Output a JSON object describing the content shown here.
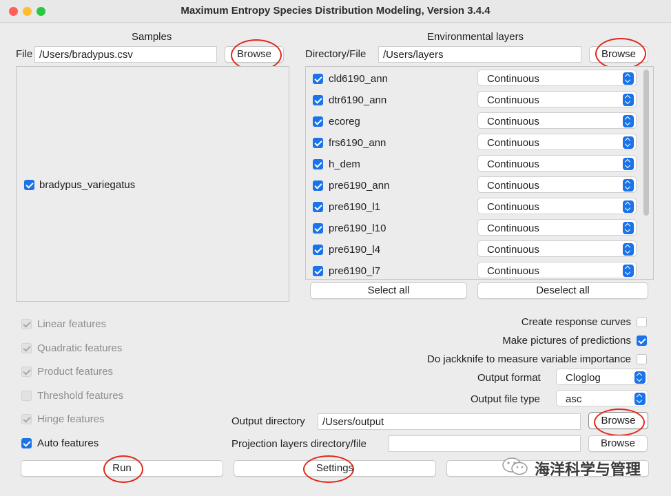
{
  "window": {
    "title": "Maximum Entropy Species Distribution Modeling, Version 3.4.4"
  },
  "samples": {
    "header": "Samples",
    "file_label": "File",
    "file_value": "/Users/bradypus.csv",
    "browse_label": "Browse",
    "species": [
      {
        "name": "bradypus_variegatus",
        "checked": true
      }
    ]
  },
  "env": {
    "header": "Environmental layers",
    "dir_label": "Directory/File",
    "dir_value": "/Users/layers",
    "browse_label": "Browse",
    "layers": [
      {
        "name": "cld6190_ann",
        "checked": true,
        "type": "Continuous"
      },
      {
        "name": "dtr6190_ann",
        "checked": true,
        "type": "Continuous"
      },
      {
        "name": "ecoreg",
        "checked": true,
        "type": "Continuous"
      },
      {
        "name": "frs6190_ann",
        "checked": true,
        "type": "Continuous"
      },
      {
        "name": "h_dem",
        "checked": true,
        "type": "Continuous"
      },
      {
        "name": "pre6190_ann",
        "checked": true,
        "type": "Continuous"
      },
      {
        "name": "pre6190_l1",
        "checked": true,
        "type": "Continuous"
      },
      {
        "name": "pre6190_l10",
        "checked": true,
        "type": "Continuous"
      },
      {
        "name": "pre6190_l4",
        "checked": true,
        "type": "Continuous"
      },
      {
        "name": "pre6190_l7",
        "checked": true,
        "type": "Continuous"
      }
    ],
    "select_all": "Select all",
    "deselect_all": "Deselect all"
  },
  "features": [
    {
      "label": "Linear features",
      "checked": true,
      "enabled": false
    },
    {
      "label": "Quadratic features",
      "checked": true,
      "enabled": false
    },
    {
      "label": "Product features",
      "checked": true,
      "enabled": false
    },
    {
      "label": "Threshold features",
      "checked": false,
      "enabled": false
    },
    {
      "label": "Hinge features",
      "checked": true,
      "enabled": false
    },
    {
      "label": "Auto features",
      "checked": true,
      "enabled": true
    }
  ],
  "options": {
    "response_curves": {
      "label": "Create response curves",
      "checked": false
    },
    "pictures": {
      "label": "Make pictures of predictions",
      "checked": true
    },
    "jackknife": {
      "label": "Do jackknife to measure variable importance",
      "checked": false
    },
    "output_format": {
      "label": "Output format",
      "value": "Cloglog"
    },
    "output_file_type": {
      "label": "Output file type",
      "value": "asc"
    }
  },
  "output": {
    "dir_label": "Output directory",
    "dir_value": "/Users/output",
    "browse_label": "Browse",
    "proj_label": "Projection layers directory/file",
    "proj_value": "",
    "proj_browse_label": "Browse"
  },
  "actions": {
    "run": "Run",
    "settings": "Settings",
    "help": ""
  },
  "watermark": "海洋科学与管理",
  "colors": {
    "accent": "#1a73e8",
    "annotation": "#e3261b",
    "traffic": [
      "#ff5f57",
      "#febc2e",
      "#28c840"
    ]
  }
}
